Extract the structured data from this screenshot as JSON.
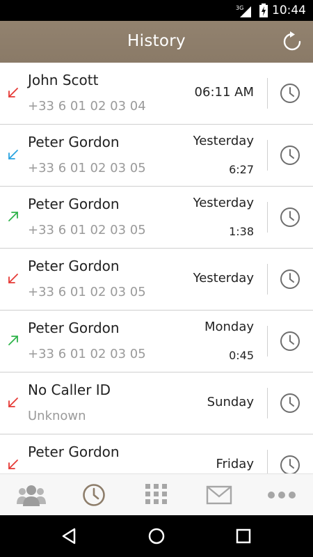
{
  "status_bar": {
    "network": "3G",
    "time": "10:44"
  },
  "app_bar": {
    "title": "History",
    "refresh_icon": "refresh-icon"
  },
  "colors": {
    "header": "#8d7d6a",
    "missed": "#e53935",
    "incoming": "#29a3e0",
    "outgoing": "#2eb34a",
    "active_tab": "#8d7d6a",
    "inactive_tab": "#a6a6a6"
  },
  "calls": [
    {
      "name": "John Scott",
      "number": "+33 6 01 02 03 04",
      "when": "06:11 AM",
      "duration": "",
      "type": "missed"
    },
    {
      "name": "Peter Gordon",
      "number": "+33 6 01 02 03 05",
      "when": "Yesterday",
      "duration": "6:27",
      "type": "incoming"
    },
    {
      "name": "Peter Gordon",
      "number": "+33 6 01 02 03 05",
      "when": "Yesterday",
      "duration": "1:38",
      "type": "outgoing"
    },
    {
      "name": "Peter Gordon",
      "number": "+33 6 01 02 03 05",
      "when": "Yesterday",
      "duration": "",
      "type": "missed"
    },
    {
      "name": "Peter Gordon",
      "number": "+33 6 01 02 03 05",
      "when": "Monday",
      "duration": "0:45",
      "type": "outgoing"
    },
    {
      "name": "No Caller ID",
      "number": "Unknown",
      "when": "Sunday",
      "duration": "",
      "type": "missed"
    },
    {
      "name": "Peter Gordon",
      "number": "",
      "when": "Friday",
      "duration": "",
      "type": "missed"
    }
  ],
  "tabs": [
    {
      "icon": "contacts-icon",
      "active": false
    },
    {
      "icon": "history-icon",
      "active": true
    },
    {
      "icon": "dialpad-icon",
      "active": false
    },
    {
      "icon": "messages-icon",
      "active": false
    },
    {
      "icon": "more-icon",
      "active": false
    }
  ],
  "nav": [
    "back-icon",
    "home-icon",
    "recents-icon"
  ]
}
